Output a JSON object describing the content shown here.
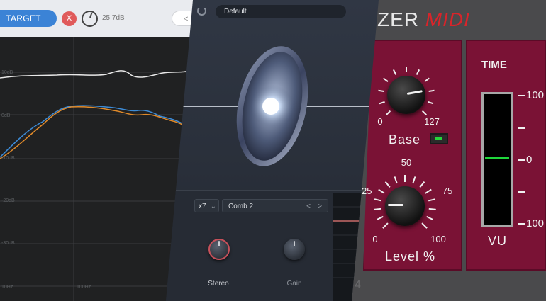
{
  "eq": {
    "target_label": "TARGET",
    "close_label": "X",
    "db_value": "25.7dB",
    "back_label": "<",
    "grid_labels": [
      "20dB",
      "10dB",
      "0dB",
      "-10dB",
      "-20dB",
      "-30dB",
      "-40dB"
    ],
    "freq_labels": [
      "10Hz",
      "100Hz"
    ],
    "series_colors": {
      "white": "#e8e8e8",
      "orange": "#e08a2a",
      "blue": "#3d8bd6"
    }
  },
  "plugin": {
    "preset_name": "Default",
    "voices": "x7",
    "mode": "Comb 2",
    "prev_label": "<",
    "next_label": ">",
    "stereo_label": "Stereo",
    "gain_label": "Gain"
  },
  "synth": {
    "brand_white": "ZER",
    "brand_red": "MIDI",
    "time_label": "TIME",
    "base_label": "Base",
    "base_min": "0",
    "base_max": "127",
    "level_label": "Level %",
    "level_ticks": [
      "0",
      "25",
      "50",
      "75",
      "100"
    ],
    "vu_label": "VU",
    "vu_scale": [
      "100",
      "–",
      "0",
      "–",
      "100"
    ],
    "bg_number": "4",
    "vu_level": 0.5
  }
}
